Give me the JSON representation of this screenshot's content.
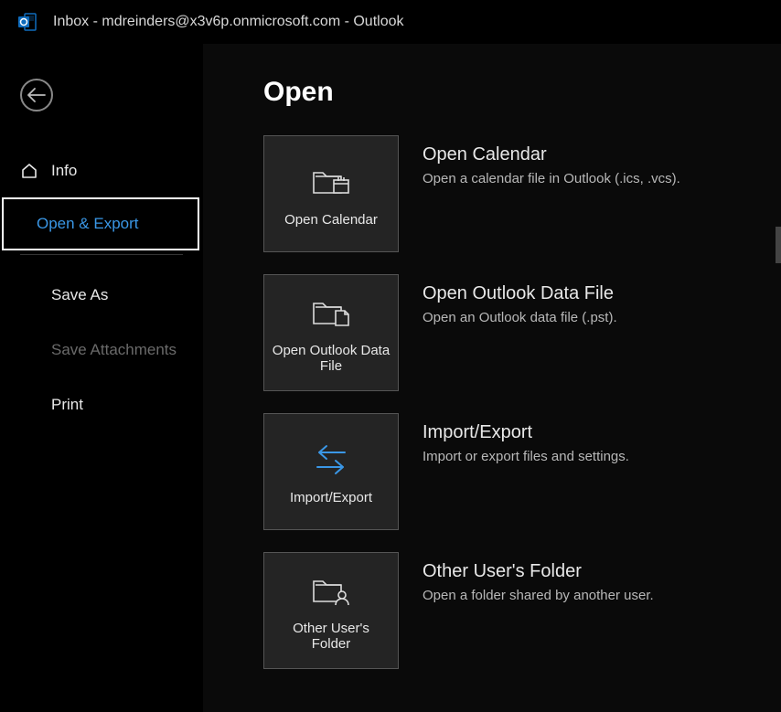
{
  "titlebar": {
    "title": "Inbox  -  mdreinders@x3v6p.onmicrosoft.com   -   Outlook"
  },
  "sidebar": {
    "info": "Info",
    "open_export": "Open & Export",
    "save_as": "Save As",
    "save_attachments": "Save Attachments",
    "print": "Print"
  },
  "main": {
    "page_title": "Open",
    "options": [
      {
        "tile_label": "Open Calendar",
        "title": "Open Calendar",
        "desc": "Open a calendar file in Outlook (.ics, .vcs)."
      },
      {
        "tile_label": "Open Outlook Data File",
        "title": "Open Outlook Data File",
        "desc": "Open an Outlook data file (.pst)."
      },
      {
        "tile_label": "Import/Export",
        "title": "Import/Export",
        "desc": "Import or export files and settings."
      },
      {
        "tile_label": "Other User's Folder",
        "title": "Other User's Folder",
        "desc": "Open a folder shared by another user."
      }
    ]
  }
}
